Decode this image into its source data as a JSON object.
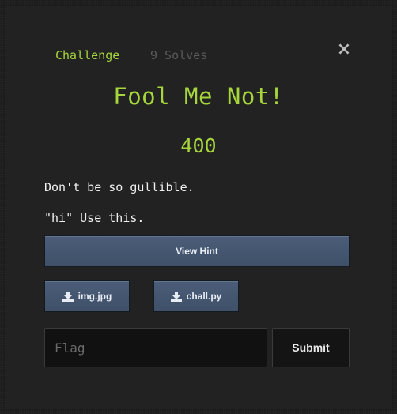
{
  "tabs": {
    "challenge": "Challenge",
    "solves": "9 Solves"
  },
  "close_icon": "×",
  "challenge": {
    "title": "Fool Me Not!",
    "points": "400",
    "description": [
      "Don't be so gullible.",
      "\"hi\" Use this."
    ]
  },
  "hint_button": "View Hint",
  "files": [
    {
      "name": "img.jpg",
      "icon": "download-icon"
    },
    {
      "name": "chall.py",
      "icon": "download-icon"
    }
  ],
  "flag_input": {
    "placeholder": "Flag",
    "value": ""
  },
  "submit_button": "Submit",
  "colors": {
    "accent": "#a6d63b",
    "button": "#465873",
    "background": "#1c1c1c"
  }
}
